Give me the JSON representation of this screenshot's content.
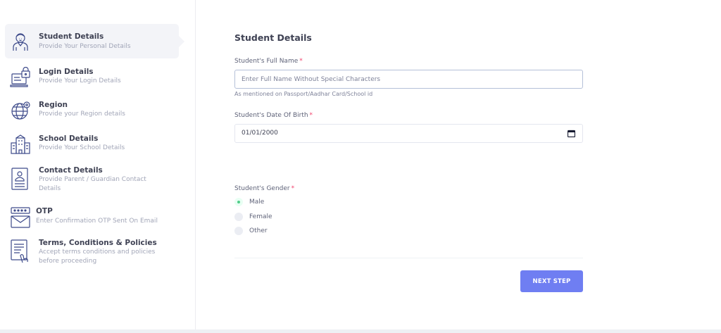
{
  "steps": [
    {
      "title": "Student Details",
      "subtitle": "Provide Your Personal Details",
      "icon": "student-icon",
      "active": true
    },
    {
      "title": "Login Details",
      "subtitle": "Provide Your Login Details",
      "icon": "login-lock-icon"
    },
    {
      "title": "Region",
      "subtitle": "Provide your Region details",
      "icon": "globe-icon"
    },
    {
      "title": "School Details",
      "subtitle": "Provide Your School Details",
      "icon": "school-building-icon"
    },
    {
      "title": "Contact Details",
      "subtitle": "Provide Parent / Guardian Contact Details",
      "icon": "contact-card-icon"
    },
    {
      "title": "OTP",
      "subtitle": "Enter Confirmation OTP Sent On Email",
      "icon": "otp-email-icon"
    },
    {
      "title": "Terms, Conditions & Policies",
      "subtitle": "Accept terms conditions and policies before proceeding",
      "icon": "terms-document-icon"
    }
  ],
  "form": {
    "title": "Student Details",
    "full_name_label": "Student's Full Name",
    "full_name_placeholder": "Enter Full Name Without Special Characters",
    "full_name_value": "",
    "full_name_hint": "As mentioned on Passport/Aadhar Card/School id",
    "dob_label": "Student's Date Of Birth",
    "dob_value": "01/01/2000",
    "gender_label": "Student's Gender",
    "gender_options": [
      "Male",
      "Female",
      "Other"
    ],
    "gender_selected": "Male",
    "required_mark": "*",
    "next_label": "NEXT STEP"
  },
  "colors": {
    "accent": "#6f7ef2",
    "required": "#f1416c",
    "radio_checked": "#50cd89",
    "icon_stroke": "#3d4a8a"
  }
}
